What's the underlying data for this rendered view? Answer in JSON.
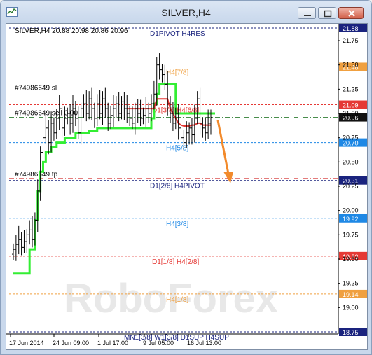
{
  "window": {
    "title": "SILVER,H4"
  },
  "chart_header": {
    "text": "SILVER,H4  20.88 20.98 20.86 20.96"
  },
  "watermark": "RoboForex",
  "arrow_color": "#f28a2b",
  "chart_data": {
    "type": "candlestick",
    "symbol": "SILVER",
    "timeframe": "H4",
    "ohlc_last": {
      "open": 20.88,
      "high": 20.98,
      "low": 20.86,
      "close": 20.96
    },
    "ylim": [
      18.75,
      21.88
    ],
    "y_ticks": [
      "21.75",
      "21.50",
      "21.25",
      "21.00",
      "20.75",
      "20.50",
      "20.25",
      "20.00",
      "19.75",
      "19.50",
      "19.25",
      "19.00"
    ],
    "x_ticks": [
      "17 Jun 2014",
      "24 Jun 09:00",
      "1 Jul 17:00",
      "9 Jul 05:00",
      "16 Jul 13:00"
    ],
    "levels": [
      {
        "label": "D1PIVOT H4RES",
        "price": 21.88,
        "badge": "21.88",
        "color": "#1a237e",
        "badge_bg": "#1a237e",
        "style": "dashed"
      },
      {
        "label": "H4[7/8]",
        "price": 21.48,
        "badge": "21.48",
        "color": "#f0a040",
        "badge_bg": "#f0a040",
        "style": "dashed"
      },
      {
        "label": "#74986649 sl",
        "price": 21.22,
        "badge": "",
        "color": "#d32f2f",
        "badge_bg": "",
        "style": "dashdot"
      },
      {
        "label": "D1[3/8] H4[6/8]",
        "price": 21.09,
        "badge": "21.09",
        "color": "#e53935",
        "badge_bg": "#e53935",
        "style": "dashed"
      },
      {
        "label": "#74986649 sell 0.00",
        "price": 20.96,
        "badge": "20.96",
        "color": "#2e7d32",
        "badge_bg": "#111111",
        "style": "dashdot"
      },
      {
        "label": "H4[5/8]",
        "price": 20.7,
        "badge": "20.70",
        "color": "#1e88e5",
        "badge_bg": "#1e88e5",
        "style": "dashed"
      },
      {
        "label": "#74986649 tp",
        "price": 20.33,
        "badge": "",
        "color": "#d32f2f",
        "badge_bg": "",
        "style": "dashdot"
      },
      {
        "label": "D1[2/8] H4PIVOT",
        "price": 20.31,
        "badge": "20.31",
        "color": "#1a237e",
        "badge_bg": "#1a237e",
        "style": "dashed"
      },
      {
        "label": "H4[3/8]",
        "price": 19.92,
        "badge": "19.92",
        "color": "#1e88e5",
        "badge_bg": "#1e88e5",
        "style": "dashed"
      },
      {
        "label": "D1[1/8] H4[2/8]",
        "price": 19.53,
        "badge": "19.53",
        "color": "#e53935",
        "badge_bg": "#e53935",
        "style": "dashed"
      },
      {
        "label": "H4[1/8]",
        "price": 19.14,
        "badge": "19.14",
        "color": "#f0a040",
        "badge_bg": "#f0a040",
        "style": "dashed"
      },
      {
        "label": "MN1[3/8] W1[3/8] D1SUP H4SUP",
        "price": 18.75,
        "badge": "18.75",
        "color": "#1a237e",
        "badge_bg": "#1a237e",
        "style": "dashed"
      }
    ],
    "candles_close": [
      19.6,
      19.65,
      19.7,
      19.62,
      19.68,
      19.75,
      19.8,
      19.7,
      19.9,
      20.2,
      20.6,
      20.75,
      20.85,
      20.7,
      20.9,
      20.8,
      20.95,
      21.05,
      20.85,
      20.95,
      21.0,
      20.9,
      21.05,
      20.95,
      20.8,
      21.05,
      21.1,
      21.0,
      21.15,
      21.05,
      20.95,
      21.1,
      21.0,
      21.15,
      21.05,
      20.9,
      20.98,
      21.05,
      21.1,
      21.0,
      21.12,
      21.05,
      21.0,
      20.95,
      20.9,
      21.05,
      21.0,
      20.95,
      20.98,
      21.05,
      21.0,
      21.1,
      21.2,
      21.5,
      21.45,
      21.4,
      21.3,
      21.1,
      21.0,
      20.9,
      21.0,
      20.85,
      20.75,
      20.7,
      20.8,
      20.85,
      20.78,
      20.95,
      21.15,
      20.9,
      20.85,
      20.8,
      20.9,
      20.96
    ],
    "green_line": [
      19.35,
      19.35,
      19.35,
      19.35,
      19.35,
      19.35,
      19.6,
      19.6,
      19.9,
      20.2,
      20.4,
      20.5,
      20.6,
      20.6,
      20.65,
      20.65,
      20.7,
      20.7,
      20.7,
      20.75,
      20.75,
      20.75,
      20.75,
      20.8,
      20.8,
      20.8,
      20.8,
      20.8,
      20.82,
      20.82,
      20.82,
      20.85,
      20.85,
      20.85,
      20.85,
      20.85,
      20.85,
      20.85,
      20.85,
      20.85,
      20.85,
      20.85,
      20.85,
      20.85,
      20.85,
      20.85,
      20.85,
      20.85,
      20.85,
      20.85,
      20.85,
      20.95,
      21.1,
      21.2,
      21.3,
      21.3,
      21.3,
      21.3,
      21.3,
      21.3,
      21.0,
      21.0,
      21.0,
      21.0,
      21.0,
      21.0,
      21.0,
      21.0,
      21.0,
      21.0,
      21.0,
      21.0,
      21.0,
      21.0
    ],
    "red_line": [
      null,
      null,
      null,
      null,
      null,
      null,
      null,
      null,
      null,
      null,
      null,
      null,
      null,
      null,
      null,
      null,
      null,
      null,
      null,
      null,
      null,
      null,
      null,
      null,
      null,
      null,
      null,
      null,
      null,
      null,
      null,
      null,
      null,
      null,
      null,
      null,
      null,
      null,
      null,
      null,
      null,
      null,
      21.05,
      21.05,
      21.05,
      21.05,
      21.05,
      21.05,
      21.05,
      21.05,
      21.05,
      21.05,
      21.05,
      21.15,
      21.15,
      21.15,
      21.15,
      21.15,
      21.05,
      21.0,
      20.95,
      20.9,
      20.88,
      20.87,
      20.87,
      20.87,
      20.88,
      20.88,
      20.9,
      20.9,
      20.88,
      20.88,
      20.88,
      20.88
    ]
  }
}
